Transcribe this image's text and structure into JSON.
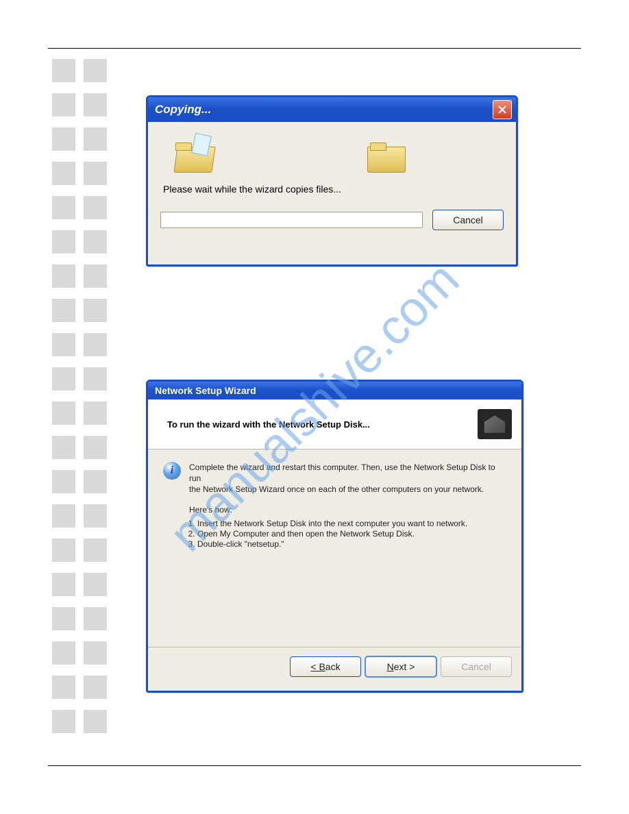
{
  "watermark": "manualshive.com",
  "dialog1": {
    "title": "Copying...",
    "message": "Please wait while the wizard copies files...",
    "cancel": "Cancel"
  },
  "dialog2": {
    "title": "Network Setup Wizard",
    "header": "To run the wizard with the Network Setup Disk...",
    "info_line1": "Complete the wizard and restart this computer. Then, use the Network Setup Disk to run",
    "info_line2": "the Network Setup Wizard once on each of the other computers on your network.",
    "heres_how": "Here's how:",
    "step1": "Insert the Network Setup Disk into the next computer you want to network.",
    "step2": "Open My Computer and then open the Network Setup Disk.",
    "step3": "Double-click \"netsetup.\"",
    "back": "< Back",
    "next": "Next >",
    "cancel": "Cancel"
  }
}
